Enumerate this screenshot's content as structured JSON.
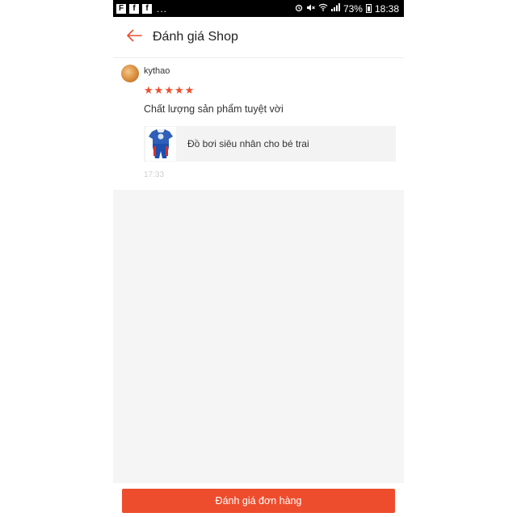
{
  "status_bar": {
    "apps": [
      "F",
      "f",
      "f"
    ],
    "more": "...",
    "battery": "73%",
    "time": "18:38"
  },
  "header": {
    "title": "Đánh giá Shop"
  },
  "review": {
    "username": "kythao",
    "rating": 5,
    "text": "Chất lượng sản phẩm tuyệt vời",
    "product_name": "Đồ bơi siêu nhân cho bé trai",
    "time": "17:33"
  },
  "footer": {
    "rate_button_label": "Đánh giá đơn hàng"
  },
  "colors": {
    "accent": "#ee4d2d"
  }
}
